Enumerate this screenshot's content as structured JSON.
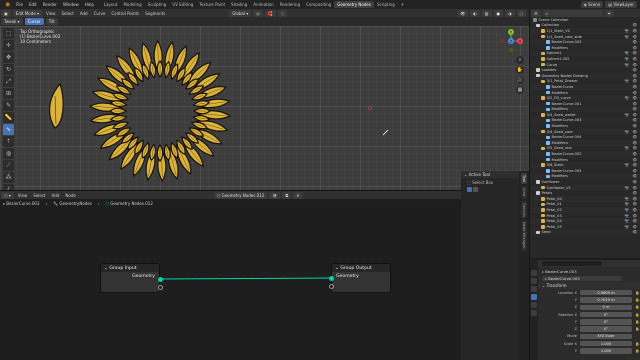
{
  "menu": {
    "items": [
      "File",
      "Edit",
      "Render",
      "Window",
      "Help"
    ]
  },
  "workspaces": [
    "Layout",
    "Modeling",
    "Sculpting",
    "UV Editing",
    "Texture Paint",
    "Shading",
    "Animation",
    "Rendering",
    "Compositing",
    "Geometry Nodes",
    "Scripting"
  ],
  "active_workspace": "Geometry Nodes",
  "scene": {
    "scene_label": "Scene",
    "view_layer_label": "ViewLayer"
  },
  "viewport": {
    "mode": "Edit Mode",
    "menus": [
      "View",
      "Select",
      "Add",
      "Curve",
      "Control Points",
      "Segments"
    ],
    "tool_settings": [
      "Tweak",
      "Cursor",
      "Tilt"
    ],
    "orientation": "Global",
    "overlay_lines": [
      "Top Orthographic",
      "(1) BezierCurve.003",
      "10 Centimeters"
    ],
    "axes": [
      "X",
      "Y",
      "Z"
    ],
    "colors": {
      "petal_fill": "#dab43a",
      "petal_outline": "#1a1209",
      "axis_x": "#e44a56",
      "axis_y": "#7dc42d",
      "axis_z": "#4a8ce4"
    }
  },
  "node_editor": {
    "menus": [
      "View",
      "Select",
      "Add",
      "Node"
    ],
    "tree_name": "Geometry Nodes.012",
    "breadcrumb": [
      "BezierCurve.003",
      "GeometryNodes",
      "Geometry Nodes.012"
    ],
    "nodes": [
      {
        "title": "Group Input",
        "socket": "Geometry"
      },
      {
        "title": "Group Output",
        "socket": "Geometry"
      }
    ],
    "link_color": "#00d6a3",
    "side_panel": {
      "header": "Active Tool",
      "tool_name": "Select Box"
    },
    "tabs": [
      "Tool",
      "View",
      "Options",
      "Node Wrangler"
    ]
  },
  "outliner": {
    "header_label": "Scene Collection",
    "items": [
      {
        "label": "Collection",
        "level": 0,
        "color": "#cfcfcf"
      },
      {
        "label": "1/1_Stem_V2",
        "level": 1,
        "color": "#ddb052"
      },
      {
        "label": "1/1_Seed_core_side",
        "level": 1,
        "color": "#ddb052"
      },
      {
        "label": "BezierCurve.003",
        "level": 2,
        "color": "#7ec1ff"
      },
      {
        "label": "Modifiers",
        "level": 2,
        "color": "#7ec1ff"
      },
      {
        "label": "Sphere1",
        "level": 1,
        "color": "#ddb052"
      },
      {
        "label": "Sphere1.002",
        "level": 1,
        "color": "#ddb052"
      },
      {
        "label": "Curve",
        "level": 1,
        "color": "#ddb052"
      },
      {
        "label": "Lookdev",
        "level": 0,
        "color": "#cfcfcf"
      },
      {
        "label": "Geometry Nodes Drawing",
        "level": 0,
        "color": "#cfcfcf"
      },
      {
        "label": "3/1_Petal_Drawer",
        "level": 1,
        "color": "#ddb052"
      },
      {
        "label": "BezierCurve",
        "level": 2,
        "color": "#7ec1ff"
      },
      {
        "label": "Modifiers",
        "level": 2,
        "color": "#7ec1ff"
      },
      {
        "label": "3/2_Fill_curve",
        "level": 1,
        "color": "#ddb052"
      },
      {
        "label": "BezierCurve.001",
        "level": 2,
        "color": "#7ec1ff"
      },
      {
        "label": "Modifiers",
        "level": 2,
        "color": "#7ec1ff"
      },
      {
        "label": "3/4_Seed_wallet",
        "level": 1,
        "color": "#ddb052"
      },
      {
        "label": "BezierCurve.003",
        "level": 2,
        "color": "#7ec1ff"
      },
      {
        "label": "Modifiers",
        "level": 2,
        "color": "#7ec1ff"
      },
      {
        "label": "3/4_Seed_core",
        "level": 1,
        "color": "#ddb052"
      },
      {
        "label": "BezierCurve.004",
        "level": 2,
        "color": "#7ec1ff"
      },
      {
        "label": "Modifiers",
        "level": 2,
        "color": "#7ec1ff"
      },
      {
        "label": "3/5_Seed_real",
        "level": 1,
        "color": "#ddb052"
      },
      {
        "label": "BezierCurve.002",
        "level": 2,
        "color": "#7ec1ff"
      },
      {
        "label": "Modifiers",
        "level": 2,
        "color": "#7ec1ff"
      },
      {
        "label": "3/6_Stem",
        "level": 1,
        "color": "#ddb052"
      },
      {
        "label": "BezierCurve.005",
        "level": 2,
        "color": "#7ec1ff"
      },
      {
        "label": "Modifiers",
        "level": 2,
        "color": "#7ec1ff"
      },
      {
        "label": "Sunflower",
        "level": 0,
        "color": "#cfcfcf"
      },
      {
        "label": "Sunflower_V1",
        "level": 1,
        "color": "#ddb052"
      },
      {
        "label": "Petals",
        "level": 0,
        "color": "#cfcfcf"
      },
      {
        "label": "Petal_00",
        "level": 1,
        "color": "#ddb052"
      },
      {
        "label": "Petal_01",
        "level": 1,
        "color": "#ddb052"
      },
      {
        "label": "Petal_02",
        "level": 1,
        "color": "#ddb052"
      },
      {
        "label": "Petal_03",
        "level": 1,
        "color": "#ddb052"
      },
      {
        "label": "Petal_04",
        "level": 1,
        "color": "#ddb052"
      },
      {
        "label": "Petal_05",
        "level": 1,
        "color": "#ddb052"
      },
      {
        "label": "Seed",
        "level": 0,
        "color": "#cfcfcf"
      }
    ]
  },
  "properties": {
    "object_name": "BezierCurve.003",
    "data_name": "BezierCurve.003",
    "section": "Transform",
    "fields": [
      {
        "label": "Location X",
        "value": "0.9609 m"
      },
      {
        "label": "Y",
        "value": "0.7019 m"
      },
      {
        "label": "Z",
        "value": "0 m"
      },
      {
        "label": "Rotation X",
        "value": "0°"
      },
      {
        "label": "Y",
        "value": "0°"
      },
      {
        "label": "Z",
        "value": "0°"
      },
      {
        "label": "Mode",
        "value": "XYZ Euler"
      },
      {
        "label": "Scale X",
        "value": "1.000"
      },
      {
        "label": "Y",
        "value": "1.000"
      }
    ]
  }
}
